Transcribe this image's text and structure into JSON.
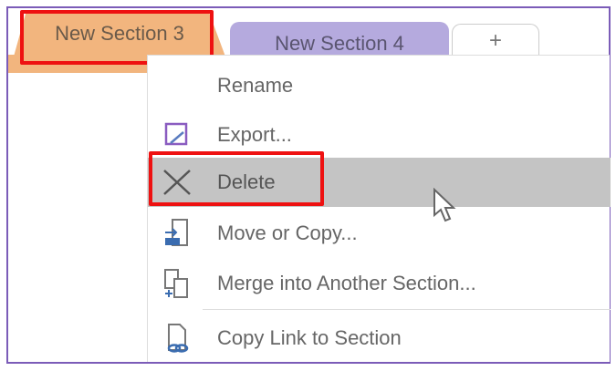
{
  "tabs": [
    {
      "label": "New Section 3",
      "color": "#f2b57e",
      "selected": true
    },
    {
      "label": "New Section 4",
      "color": "#b5aade"
    },
    {
      "label": "+"
    }
  ],
  "menu": {
    "items": [
      {
        "label": "Rename",
        "icon": "none"
      },
      {
        "label": "Export...",
        "icon": "export-icon"
      },
      {
        "label": "Delete",
        "icon": "x-icon",
        "highlighted": true
      },
      {
        "label": "Move or Copy...",
        "icon": "move-copy-icon"
      },
      {
        "label": "Merge into Another Section...",
        "icon": "merge-icon"
      },
      {
        "label": "Copy Link to Section",
        "icon": "link-icon"
      }
    ]
  },
  "colors": {
    "frame": "#7b5cb8",
    "highlight_box": "#ee1111",
    "menu_hover": "#c4c4c4"
  }
}
